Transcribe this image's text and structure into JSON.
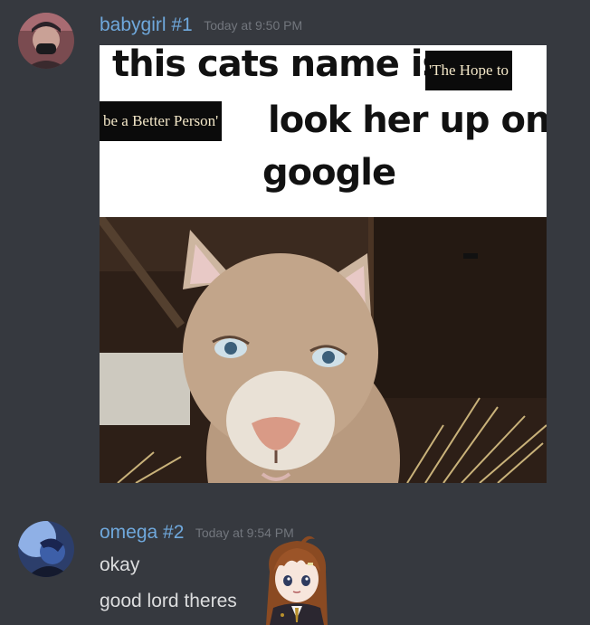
{
  "messages": [
    {
      "username": "babygirl #1",
      "timestamp": "Today at 9:50 PM",
      "meme": {
        "line1": "this cats name is",
        "box1": "'The Hope to",
        "box2": "be a Better Person'",
        "line2": "look her up on",
        "line3": "google"
      }
    },
    {
      "username": "omega #2",
      "timestamp": "Today at 9:54 PM",
      "lines": [
        "okay",
        "good lord theres"
      ]
    }
  ],
  "colors": {
    "background": "#36393f",
    "username": "#6fa8dc",
    "timestamp": "#72767d",
    "text": "#dcddde"
  }
}
